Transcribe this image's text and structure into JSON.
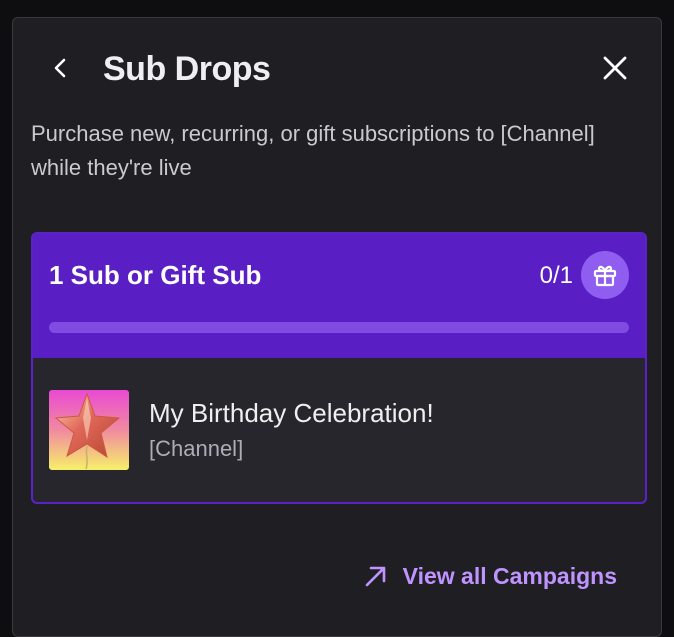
{
  "header": {
    "title": "Sub Drops",
    "back_icon": "chevron-left-icon",
    "close_icon": "close-icon"
  },
  "description": "Purchase new, recurring, or gift subscriptions to [Channel] while they're live",
  "campaign": {
    "title": "1 Sub or Gift Sub",
    "progress_text": "0/1",
    "progress_fraction": 0.0,
    "badge_icon": "gift-icon",
    "reward": {
      "name": "My Birthday Celebration!",
      "channel": "[Channel]",
      "image_icon": "star-balloon-icon"
    }
  },
  "footer": {
    "view_all_label": "View all Campaigns",
    "view_all_icon": "arrow-up-right-icon"
  },
  "colors": {
    "background": "#1f1f23",
    "card_header": "#5a1fc4",
    "accent": "#bf94ff",
    "text_primary": "#efeff1"
  }
}
